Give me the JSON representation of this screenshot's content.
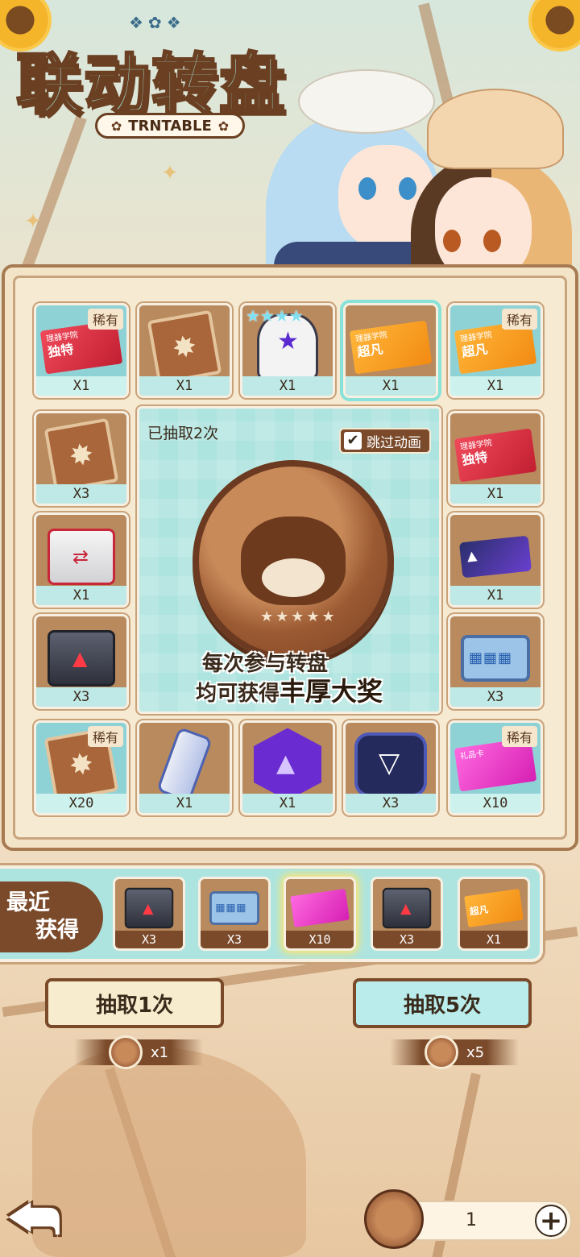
{
  "header": {
    "title": "联动转盘",
    "subtitle": "TRNTABLE"
  },
  "colors": {
    "accent_teal": "#aee4df",
    "brown": "#7a4a2a",
    "selected_outline": "#89e2d8",
    "rare_bg": "#8fd2d6"
  },
  "board": {
    "cells": [
      {
        "qty": "X1",
        "tag": "稀有",
        "icon": "red-ticket-icon",
        "ticket_text": "独特",
        "ticket_small": "理器学院"
      },
      {
        "qty": "X1",
        "tag": "",
        "icon": "map-fragment-icon"
      },
      {
        "qty": "X1",
        "tag": "",
        "icon": "robot-figure-icon",
        "stars": 4
      },
      {
        "qty": "X1",
        "tag": "",
        "icon": "orange-ticket-icon",
        "ticket_text": "超凡",
        "ticket_small": "理器学院",
        "selected": true
      },
      {
        "qty": "X1",
        "tag": "稀有",
        "icon": "orange-ticket-icon",
        "ticket_text": "超凡",
        "ticket_small": "理器学院"
      },
      {
        "qty": "X3",
        "tag": "",
        "icon": "map-fragment-icon"
      },
      {
        "qty": "X1",
        "tag": "",
        "icon": "red-ticket-icon",
        "ticket_text": "独特",
        "ticket_small": "理器学院"
      },
      {
        "qty": "X1",
        "tag": "",
        "icon": "red-white-crate-icon"
      },
      {
        "qty": "X1",
        "tag": "",
        "icon": "purple-card-icon"
      },
      {
        "qty": "X3",
        "tag": "",
        "icon": "dark-supply-box-icon"
      },
      {
        "qty": "X3",
        "tag": "",
        "icon": "blue-case-icon"
      },
      {
        "qty": "X20",
        "tag": "稀有",
        "icon": "map-fragment-icon"
      },
      {
        "qty": "X1",
        "tag": "",
        "icon": "energy-can-icon"
      },
      {
        "qty": "X1",
        "tag": "",
        "icon": "purple-hex-badge-icon"
      },
      {
        "qty": "X3",
        "tag": "",
        "icon": "triangle-emblem-icon"
      },
      {
        "qty": "X10",
        "tag": "稀有",
        "icon": "pink-gift-card-icon",
        "ticket_text": "",
        "ticket_small": "礼品卡"
      }
    ]
  },
  "center": {
    "draw_count": "已抽取2次",
    "skip_label": "跳过动画",
    "skip_checked": true,
    "promo_line1": "每次参与转盘",
    "promo_line2_a": "均可获得",
    "promo_line2_b": "丰厚大奖"
  },
  "recent": {
    "label_line1": "最近",
    "label_line2": "获得",
    "items": [
      {
        "qty": "X3",
        "icon": "dark-supply-box-icon"
      },
      {
        "qty": "X3",
        "icon": "blue-case-icon"
      },
      {
        "qty": "X10",
        "icon": "pink-gift-card-icon",
        "glow": true
      },
      {
        "qty": "X3",
        "icon": "dark-supply-box-icon"
      },
      {
        "qty": "X1",
        "icon": "orange-ticket-icon",
        "ticket_text": "超凡"
      }
    ]
  },
  "actions": {
    "draw1_label": "抽取1次",
    "draw1_cost": "x1",
    "draw5_label": "抽取5次",
    "draw5_cost": "x5"
  },
  "footer": {
    "coin_count": "1",
    "plus_label": "+"
  }
}
